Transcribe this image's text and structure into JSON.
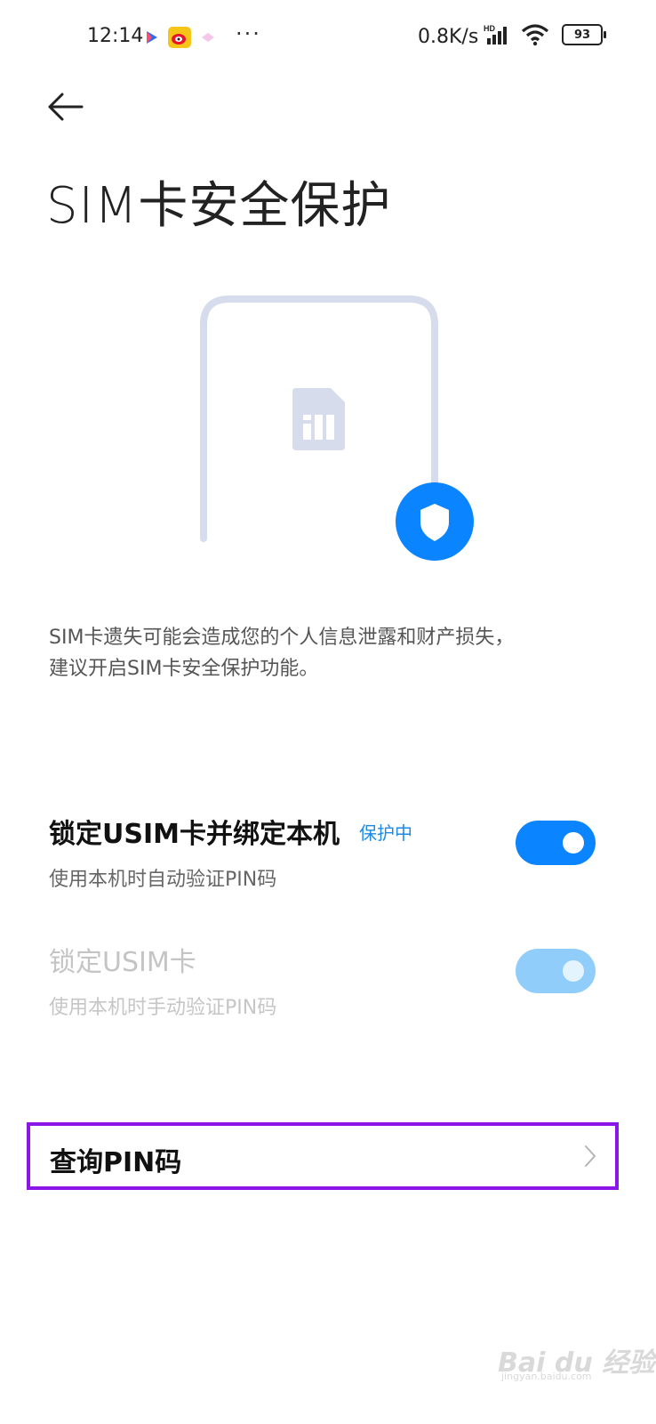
{
  "status_bar": {
    "time": "12:14",
    "speed": "0.8K/s",
    "network_label": "HD",
    "battery": "93",
    "dots": "···"
  },
  "page": {
    "title": "SIM卡安全保护",
    "description_line1": "SIM卡遗失可能会造成您的个人信息泄露和财产损失，",
    "description_line2": "建议开启SIM卡安全保护功能。"
  },
  "settings": [
    {
      "label": "锁定USIM卡并绑定本机",
      "badge": "保护中",
      "sub": "使用本机时自动验证PIN码",
      "on": true,
      "enabled": true
    },
    {
      "label": "锁定USIM卡",
      "sub": "使用本机时手动验证PIN码",
      "on": true,
      "enabled": false
    }
  ],
  "pin_query": {
    "label": "查询PIN码"
  },
  "watermark": {
    "text": "Bai du 经验",
    "sub": "jingyan.baidu.com"
  },
  "colors": {
    "accent": "#0a84ff",
    "highlight": "#8a16e8",
    "illustration": "#d6dcec"
  },
  "icons": [
    "back-arrow-icon",
    "sim-card-icon",
    "shield-icon",
    "chevron-right-icon",
    "wifi-icon",
    "signal-icon",
    "battery-icon"
  ]
}
